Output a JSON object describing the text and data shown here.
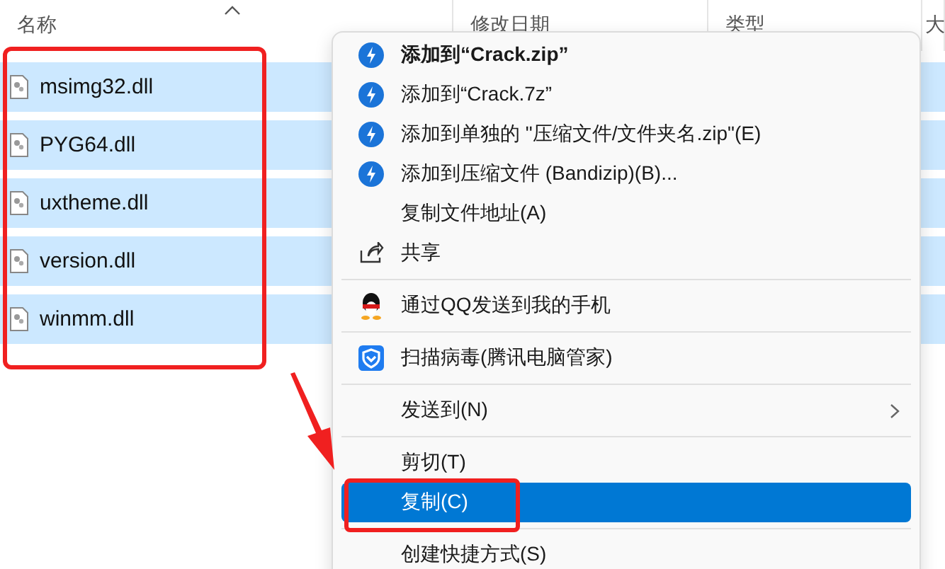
{
  "header": {
    "columns": [
      {
        "label": "名称",
        "sorted": true
      },
      {
        "label": "修改日期",
        "sorted": false
      },
      {
        "label": "类型",
        "sorted": false
      },
      {
        "label": "大",
        "sorted": false
      }
    ]
  },
  "files": [
    {
      "name": "msimg32.dll",
      "selected": true
    },
    {
      "name": "PYG64.dll",
      "selected": true
    },
    {
      "name": "uxtheme.dll",
      "selected": true
    },
    {
      "name": "version.dll",
      "selected": true
    },
    {
      "name": "winmm.dll",
      "selected": true
    }
  ],
  "context_menu": {
    "items": [
      {
        "kind": "archive",
        "label": "添加到“Crack.zip”",
        "bold": true,
        "selected": false
      },
      {
        "kind": "archive",
        "label": "添加到“Crack.7z”",
        "bold": false,
        "selected": false
      },
      {
        "kind": "archive",
        "label": "添加到单独的 \"压缩文件/文件夹名.zip\"(E)",
        "bold": false,
        "selected": false
      },
      {
        "kind": "archive",
        "label": "添加到压缩文件 (Bandizip)(B)...",
        "bold": false,
        "selected": false
      },
      {
        "kind": "plain",
        "label": "复制文件地址(A)",
        "bold": false,
        "selected": false
      },
      {
        "kind": "share",
        "label": "共享",
        "bold": false,
        "selected": false
      },
      {
        "kind": "separator"
      },
      {
        "kind": "qq",
        "label": "通过QQ发送到我的手机",
        "bold": false,
        "selected": false
      },
      {
        "kind": "separator"
      },
      {
        "kind": "scan",
        "label": "扫描病毒(腾讯电脑管家)",
        "bold": false,
        "selected": false
      },
      {
        "kind": "separator"
      },
      {
        "kind": "submenu",
        "label": "发送到(N)",
        "bold": false,
        "selected": false
      },
      {
        "kind": "separator"
      },
      {
        "kind": "plain",
        "label": "剪切(T)",
        "bold": false,
        "selected": false
      },
      {
        "kind": "plain",
        "label": "复制(C)",
        "bold": false,
        "selected": true
      },
      {
        "kind": "separator"
      },
      {
        "kind": "plain",
        "label": "创建快捷方式(S)",
        "bold": false,
        "selected": false
      }
    ]
  }
}
